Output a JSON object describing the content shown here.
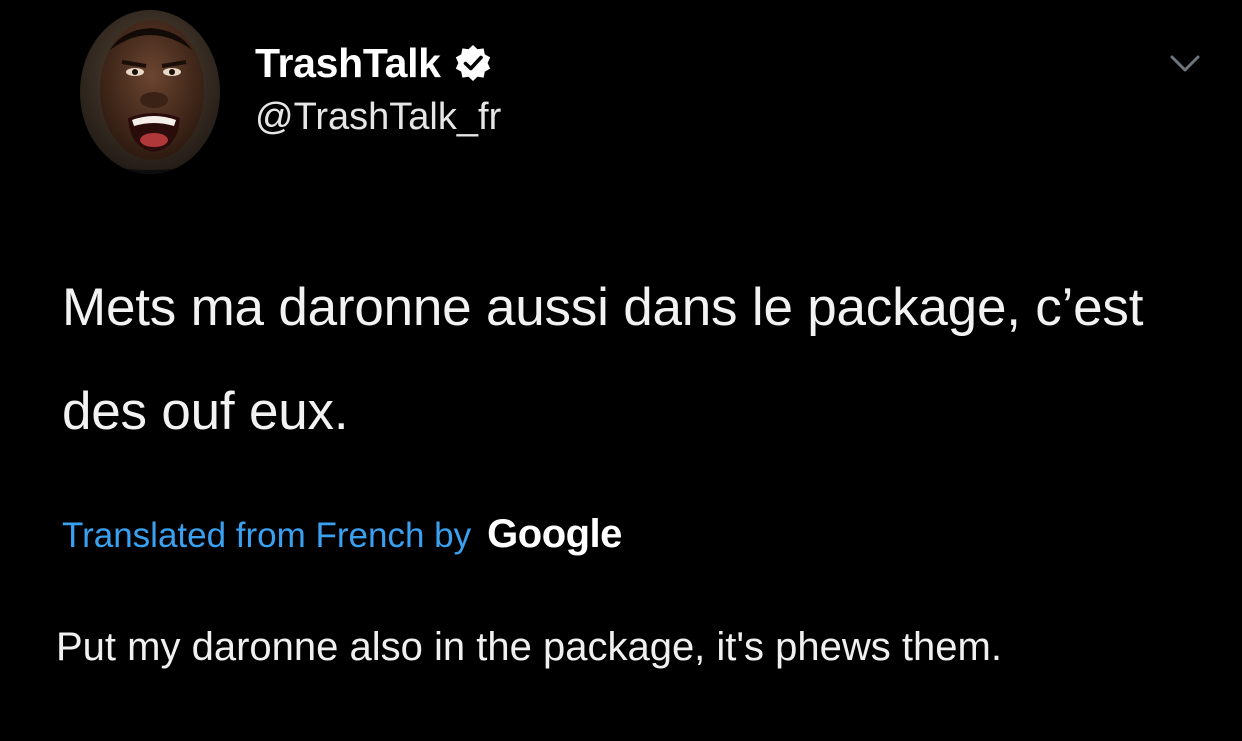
{
  "tweet": {
    "author": {
      "display_name": "TrashTalk",
      "handle": "@TrashTalk_fr",
      "verified": true,
      "avatar_icon": "avatar-photo-icon"
    },
    "menu_icon": "chevron-down-icon",
    "text": "Mets ma daronne aussi dans le package, c’est des ouf eux.",
    "translation": {
      "label": "Translated from French by",
      "provider": "Google",
      "text": "Put my daronne also in the package, it's phews them."
    }
  },
  "colors": {
    "background": "#000000",
    "text": "#ffffff",
    "link": "#3aa0f0"
  }
}
